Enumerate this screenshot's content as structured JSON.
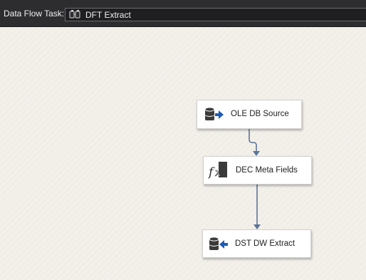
{
  "taskbar": {
    "label": "Data Flow Task:",
    "selected_task": "DFT Extract",
    "selected_task_icon": "data-flow-task-icon"
  },
  "components": [
    {
      "label": "OLE DB Source",
      "icon": "ole-db-source-icon"
    },
    {
      "label": "DEC Meta Fields",
      "icon": "derived-column-fx-icon"
    },
    {
      "label": "DST DW Extract",
      "icon": "ole-db-destination-icon"
    }
  ],
  "colors": {
    "taskbar_bg": "#2d2d30",
    "canvas_bg": "#f3f0ea",
    "flow_line": "#5b7598",
    "arrow_blue": "#1f5bb5"
  }
}
